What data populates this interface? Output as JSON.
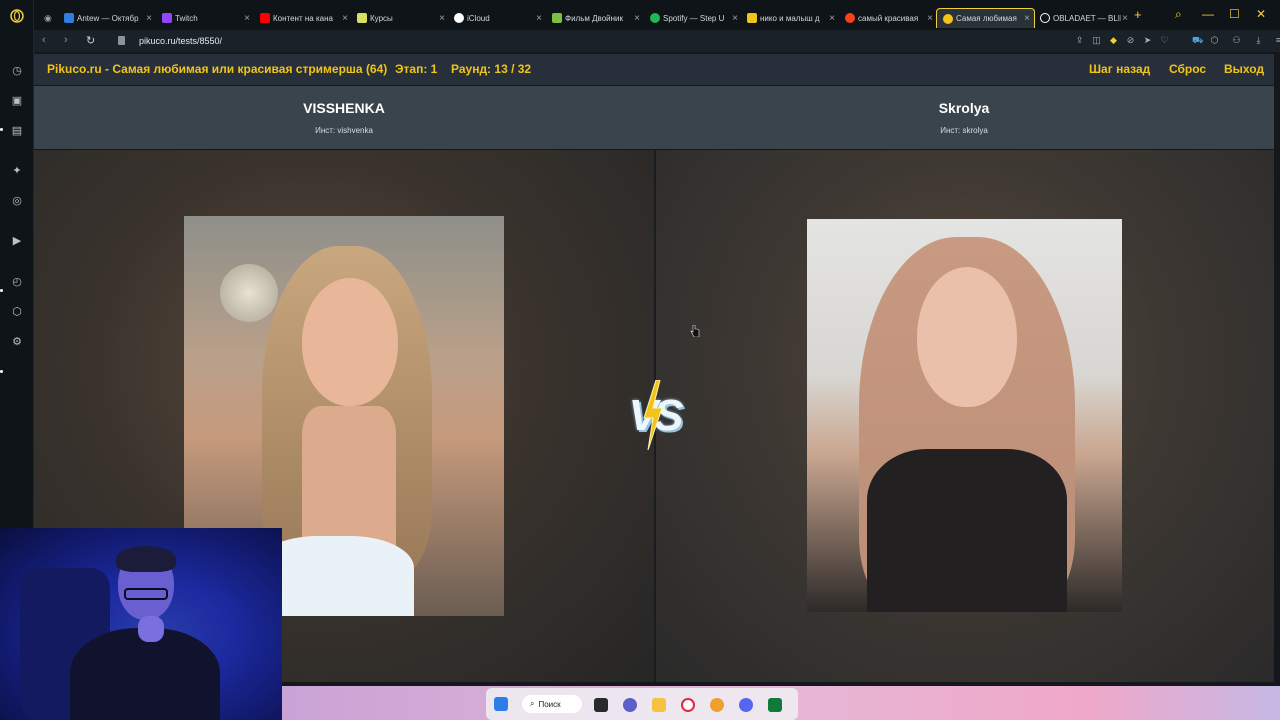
{
  "browser": {
    "tabs": [
      {
        "label": "",
        "icon": "gamepad-icon",
        "color": "#9aa3ab"
      },
      {
        "label": "Antew — Октябр",
        "icon": "vk-icon",
        "color": "#2f7de1"
      },
      {
        "label": "Twitch",
        "icon": "twitch-icon",
        "color": "#9146ff"
      },
      {
        "label": "Контент на кана",
        "icon": "youtube-icon",
        "color": "#ff0000"
      },
      {
        "label": "Курсы",
        "icon": "course-icon",
        "color": "#d8e060"
      },
      {
        "label": "iCloud",
        "icon": "apple-icon",
        "color": "#ffffff"
      },
      {
        "label": "Фильм Двойник",
        "icon": "hd-icon",
        "color": "#7bc043"
      },
      {
        "label": "Spotify — Step U",
        "icon": "spotify-icon",
        "color": "#1db954"
      },
      {
        "label": "нико и малыш д",
        "icon": "flag-icon",
        "color": "#f0c419"
      },
      {
        "label": "самый красивая",
        "icon": "yandex-icon",
        "color": "#fc3f1d"
      },
      {
        "label": "Самая любимая",
        "icon": "pikuco-icon",
        "color": "#f0c419"
      },
      {
        "label": "OBLADAET — BLIN",
        "icon": "loading-icon",
        "color": "#ffffff"
      }
    ],
    "url": "pikuco.ru/tests/8550/"
  },
  "header": {
    "title": "Pikuco.ru - Самая любимая или красивая стримерша (64)",
    "stage": "Этап: 1",
    "round": "Раунд: 13 / 32",
    "back": "Шаг назад",
    "reset": "Сброс",
    "exit": "Выход"
  },
  "candidates": [
    {
      "name": "VISSHENKA",
      "inst": "Инст: vishvenka"
    },
    {
      "name": "Skrolya",
      "inst": "Инст: skrolya"
    }
  ],
  "taskbar": {
    "search_label": "Поиск"
  },
  "colors": {
    "accent": "#f0c419",
    "header_bg": "#27303a",
    "names_bg": "#3a444c"
  }
}
